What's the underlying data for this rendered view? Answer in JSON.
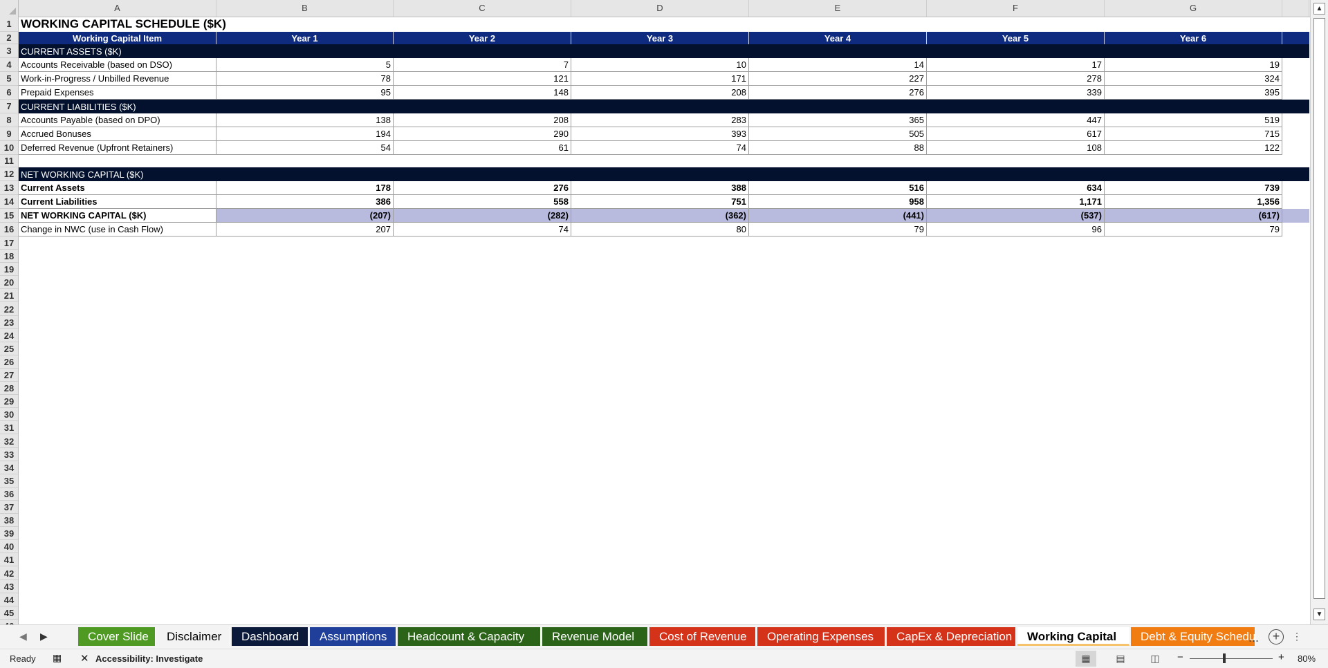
{
  "columns": [
    "A",
    "B",
    "C",
    "D",
    "E",
    "F",
    "G"
  ],
  "title": "WORKING CAPITAL SCHEDULE ($K)",
  "header": {
    "item": "Working Capital Item",
    "years": [
      "Year 1",
      "Year 2",
      "Year 3",
      "Year 4",
      "Year 5",
      "Year 6"
    ]
  },
  "sections": {
    "current_assets": "CURRENT ASSETS ($K)",
    "current_liabilities": "CURRENT LIABILITIES ($K)",
    "nwc": "NET WORKING CAPITAL ($K)"
  },
  "rows": {
    "ar": {
      "label": "Accounts Receivable (based on DSO)",
      "values": [
        "5",
        "7",
        "10",
        "14",
        "17",
        "19"
      ]
    },
    "wip": {
      "label": "Work-in-Progress / Unbilled Revenue",
      "values": [
        "78",
        "121",
        "171",
        "227",
        "278",
        "324"
      ]
    },
    "prepaid": {
      "label": "Prepaid Expenses",
      "values": [
        "95",
        "148",
        "208",
        "276",
        "339",
        "395"
      ]
    },
    "ap": {
      "label": "Accounts Payable (based on DPO)",
      "values": [
        "138",
        "208",
        "283",
        "365",
        "447",
        "519"
      ]
    },
    "bonus": {
      "label": "Accrued Bonuses",
      "values": [
        "194",
        "290",
        "393",
        "505",
        "617",
        "715"
      ]
    },
    "deferred": {
      "label": "Deferred Revenue (Upfront Retainers)",
      "values": [
        "54",
        "61",
        "74",
        "88",
        "108",
        "122"
      ]
    },
    "ca": {
      "label": "Current Assets",
      "values": [
        "178",
        "276",
        "388",
        "516",
        "634",
        "739"
      ]
    },
    "cl": {
      "label": "Current Liabilities",
      "values": [
        "386",
        "558",
        "751",
        "958",
        "1,171",
        "1,356"
      ]
    },
    "nwc": {
      "label": "NET WORKING CAPITAL ($K)",
      "values": [
        "(207)",
        "(282)",
        "(362)",
        "(441)",
        "(537)",
        "(617)"
      ]
    },
    "change": {
      "label": "Change in NWC (use in Cash Flow)",
      "values": [
        "207",
        "74",
        "80",
        "79",
        "96",
        "79"
      ]
    }
  },
  "tabs": [
    {
      "label": "Cover Slide",
      "bg": "#4e9a23",
      "fg": "#ffffff"
    },
    {
      "label": "Disclaimer",
      "bg": "#f3f3f3",
      "fg": "#000000"
    },
    {
      "label": "Dashboard",
      "bg": "#0b1a3a",
      "fg": "#ffffff"
    },
    {
      "label": "Assumptions",
      "bg": "#1f3f9a",
      "fg": "#ffffff"
    },
    {
      "label": "Headcount & Capacity",
      "bg": "#2b6319",
      "fg": "#ffffff"
    },
    {
      "label": "Revenue Model",
      "bg": "#2b6319",
      "fg": "#ffffff"
    },
    {
      "label": "Cost of Revenue",
      "bg": "#d4331a",
      "fg": "#ffffff"
    },
    {
      "label": "Operating Expenses",
      "bg": "#d4331a",
      "fg": "#ffffff"
    },
    {
      "label": "CapEx & Depreciation",
      "bg": "#d4331a",
      "fg": "#ffffff"
    },
    {
      "label": "Working Capital",
      "bg": "#ffffff",
      "fg": "#000000",
      "active": true
    },
    {
      "label": "Debt & Equity Schedu",
      "bg": "#f07c12",
      "fg": "#ffffff"
    }
  ],
  "tab_more": "...",
  "status": {
    "ready": "Ready",
    "accessibility": "Accessibility: Investigate",
    "zoom": "80%",
    "zoom_fraction": 0.4
  }
}
